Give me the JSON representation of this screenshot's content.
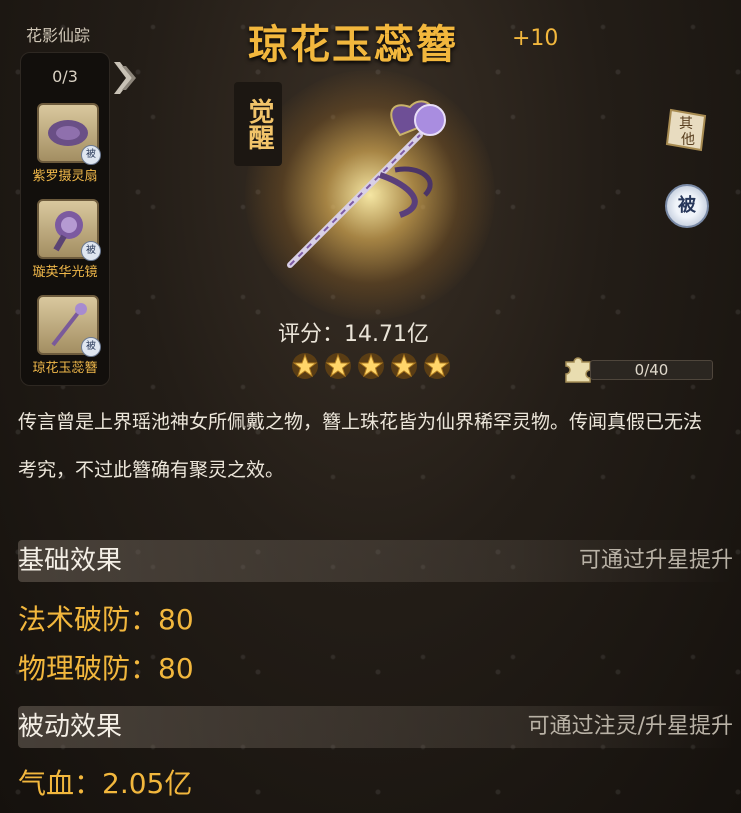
{
  "left_panel": {
    "title": "花影仙踪",
    "count": "0/3",
    "items": [
      {
        "label": "紫罗摄灵扇",
        "badge": "被"
      },
      {
        "label": "璇英华光镜",
        "badge": "被"
      },
      {
        "label": "琼花玉蕊簪",
        "badge": "被"
      }
    ]
  },
  "item": {
    "name": "琼花玉蕊簪",
    "level": "+10",
    "awaken_label": "觉醒",
    "other_button": "其他",
    "passive_badge": "被",
    "score": "评分：14.71亿",
    "stars": 5,
    "fragment_progress": "0/40",
    "description": "传言曾是上界瑶池神女所佩戴之物，簪上珠花皆为仙界稀罕灵物。传闻真假已无法考究，不过此簪确有聚灵之效。"
  },
  "basic_effects": {
    "title": "基础效果",
    "hint": "可通过升星提升",
    "stats": [
      "法术破防：80",
      "物理破防：80"
    ]
  },
  "passive_effects": {
    "title": "被动效果",
    "hint": "可通过注灵/升星提升",
    "stats": [
      "气血：2.05亿"
    ]
  },
  "colors": {
    "gold": "#f2b73d",
    "background": "#231d17"
  }
}
